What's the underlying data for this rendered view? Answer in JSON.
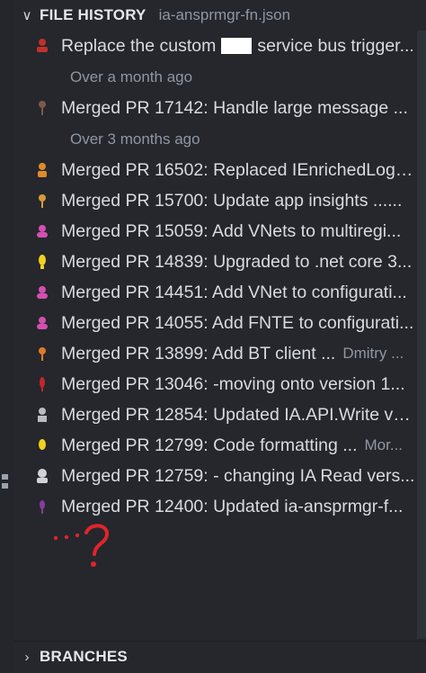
{
  "file_history": {
    "title": "FILE HISTORY",
    "file_name": "ia-ansprmgr-fn.json"
  },
  "commits": [
    {
      "label_pre": "Replace the custom",
      "label_post": "service bus trigger...",
      "avatar_color": "#c0312b",
      "icon": "avatar-icon"
    },
    {
      "group_label": "Over a month ago"
    },
    {
      "label": "Merged PR 17142: Handle large message ...",
      "avatar_color": "#7a5a4a",
      "icon": "avatar-icon"
    },
    {
      "group_label": "Over 3 months ago"
    },
    {
      "label": "Merged PR 16502: Replaced IEnrichedLogg...",
      "avatar_color": "#e08a2a",
      "icon": "avatar-icon"
    },
    {
      "label": "Merged PR 15700: Update app insights ......",
      "avatar_color": "#d99a3a",
      "icon": "avatar-icon"
    },
    {
      "label": "Merged PR 15059: Add VNets to multiregi...",
      "avatar_color": "#d44fb0",
      "icon": "avatar-icon"
    },
    {
      "label": "Merged PR 14839: Upgraded to .net core 3...",
      "avatar_color": "#f2d21f",
      "icon": "avatar-icon"
    },
    {
      "label": "Merged PR 14451: Add VNet to configurati...",
      "avatar_color": "#d44fb0",
      "icon": "avatar-icon"
    },
    {
      "label": "Merged PR 14055: Add FNTE to configurati...",
      "avatar_color": "#d44fb0",
      "icon": "avatar-icon"
    },
    {
      "label": "Merged PR 13899: Add BT client ...",
      "author": "Dmitry ...",
      "avatar_color": "#e07a2a",
      "icon": "avatar-icon"
    },
    {
      "label": "Merged PR 13046: -moving onto version 1...",
      "avatar_color": "#c4262c",
      "icon": "avatar-icon"
    },
    {
      "label": "Merged PR 12854: Updated IA.API.Write ve...",
      "avatar_color": "#b8bcc2",
      "icon": "avatar-icon"
    },
    {
      "label": "Merged PR 12799: Code formatting ...",
      "author": "Mor...",
      "avatar_color": "#f2d21f",
      "icon": "avatar-icon"
    },
    {
      "label": "Merged PR 12759: - changing IA Read vers...",
      "avatar_color": "#cfd3d8",
      "icon": "avatar-icon"
    },
    {
      "label": "Merged PR 12400: Updated ia-ansprmgr-f...",
      "avatar_color": "#8a3aa0",
      "icon": "avatar-icon"
    }
  ],
  "annotation": {
    "text": "...?",
    "color": "#e0252b"
  },
  "branches": {
    "title": "BRANCHES"
  }
}
